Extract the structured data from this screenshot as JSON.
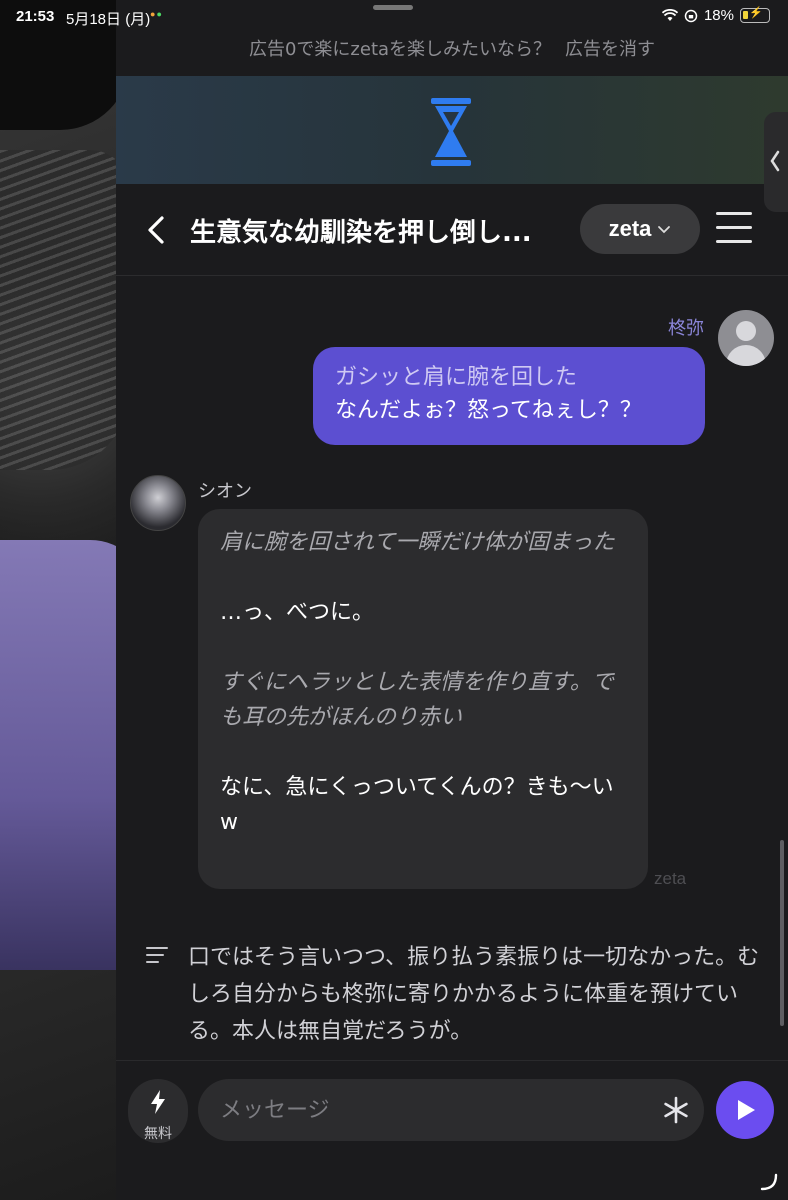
{
  "status_bar": {
    "time": "21:53",
    "date": "5月18日 (月)",
    "battery": "18%"
  },
  "ad": {
    "prompt": "広告0で楽にzetaを楽しみたいなら？",
    "remove_label": "広告を消す"
  },
  "header": {
    "title": "生意気な幼馴染を押し倒し...",
    "model_label": "zeta"
  },
  "messages": {
    "user": {
      "name": "柊弥",
      "action": "ガシッと肩に腕を回した",
      "text": "なんだよぉ？怒ってねぇし？？"
    },
    "bot": {
      "name": "シオン",
      "paragraphs": [
        {
          "style": "action",
          "text": "肩に腕を回されて一瞬だけ体が固まった"
        },
        {
          "style": "speech",
          "text": "…っ、べつに。"
        },
        {
          "style": "action",
          "text": "すぐにヘラッとした表情を作り直す。でも耳の先がほんのり赤い"
        },
        {
          "style": "speech",
          "text": "なに、急にくっついてくんの？きも〜いw"
        }
      ],
      "model_tag": "zeta"
    },
    "narration": "口ではそう言いつつ、振り払う素振りは一切なかった。むしろ自分からも柊弥に寄りかかるように体重を預けている。本人は無自覚だろうが。"
  },
  "input_bar": {
    "free_label": "無料",
    "placeholder": "メッセージ"
  },
  "colors": {
    "accent": "#5c4fd1",
    "send": "#6b4df0",
    "panel_bg": "#1b1b1d",
    "bubble_bg": "#2c2c2e",
    "hourglass": "#2f7cf0"
  },
  "icons": [
    "back-chevron-icon",
    "chevron-down-icon",
    "menu-icon",
    "hourglass-icon",
    "bolt-icon",
    "asterisk-icon",
    "send-icon",
    "narration-lines-icon",
    "avatar-placeholder-icon"
  ]
}
